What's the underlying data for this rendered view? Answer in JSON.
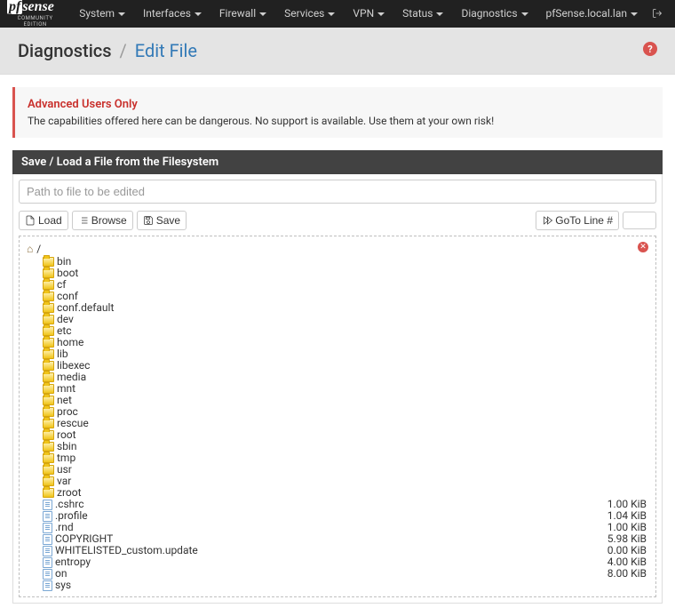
{
  "nav": {
    "items": [
      "System",
      "Interfaces",
      "Firewall",
      "Services",
      "VPN",
      "Status",
      "Diagnostics",
      "pfSense.local.lan"
    ]
  },
  "header": {
    "section": "Diagnostics",
    "page": "Edit File"
  },
  "alert": {
    "title": "Advanced Users Only",
    "text": "The capabilities offered here can be dangerous. No support is available. Use them at your own risk!"
  },
  "panel": {
    "title": "Save / Load a File from the Filesystem",
    "path_placeholder": "Path to file to be edited",
    "btn_load": "Load",
    "btn_browse": "Browse",
    "btn_save": "Save",
    "btn_goto": "GoTo Line #"
  },
  "browser": {
    "root": "/",
    "dirs": [
      "bin",
      "boot",
      "cf",
      "conf",
      "conf.default",
      "dev",
      "etc",
      "home",
      "lib",
      "libexec",
      "media",
      "mnt",
      "net",
      "proc",
      "rescue",
      "root",
      "sbin",
      "tmp",
      "usr",
      "var",
      "zroot"
    ],
    "files": [
      {
        "name": ".cshrc",
        "size": "1.00 KiB"
      },
      {
        "name": ".profile",
        "size": "1.04 KiB"
      },
      {
        "name": ".rnd",
        "size": "1.00 KiB"
      },
      {
        "name": "COPYRIGHT",
        "size": "5.98 KiB"
      },
      {
        "name": "WHITELISTED_custom.update",
        "size": "0.00 KiB"
      },
      {
        "name": "entropy",
        "size": "4.00 KiB"
      },
      {
        "name": "on",
        "size": "8.00 KiB"
      },
      {
        "name": "sys",
        "size": ""
      }
    ]
  }
}
